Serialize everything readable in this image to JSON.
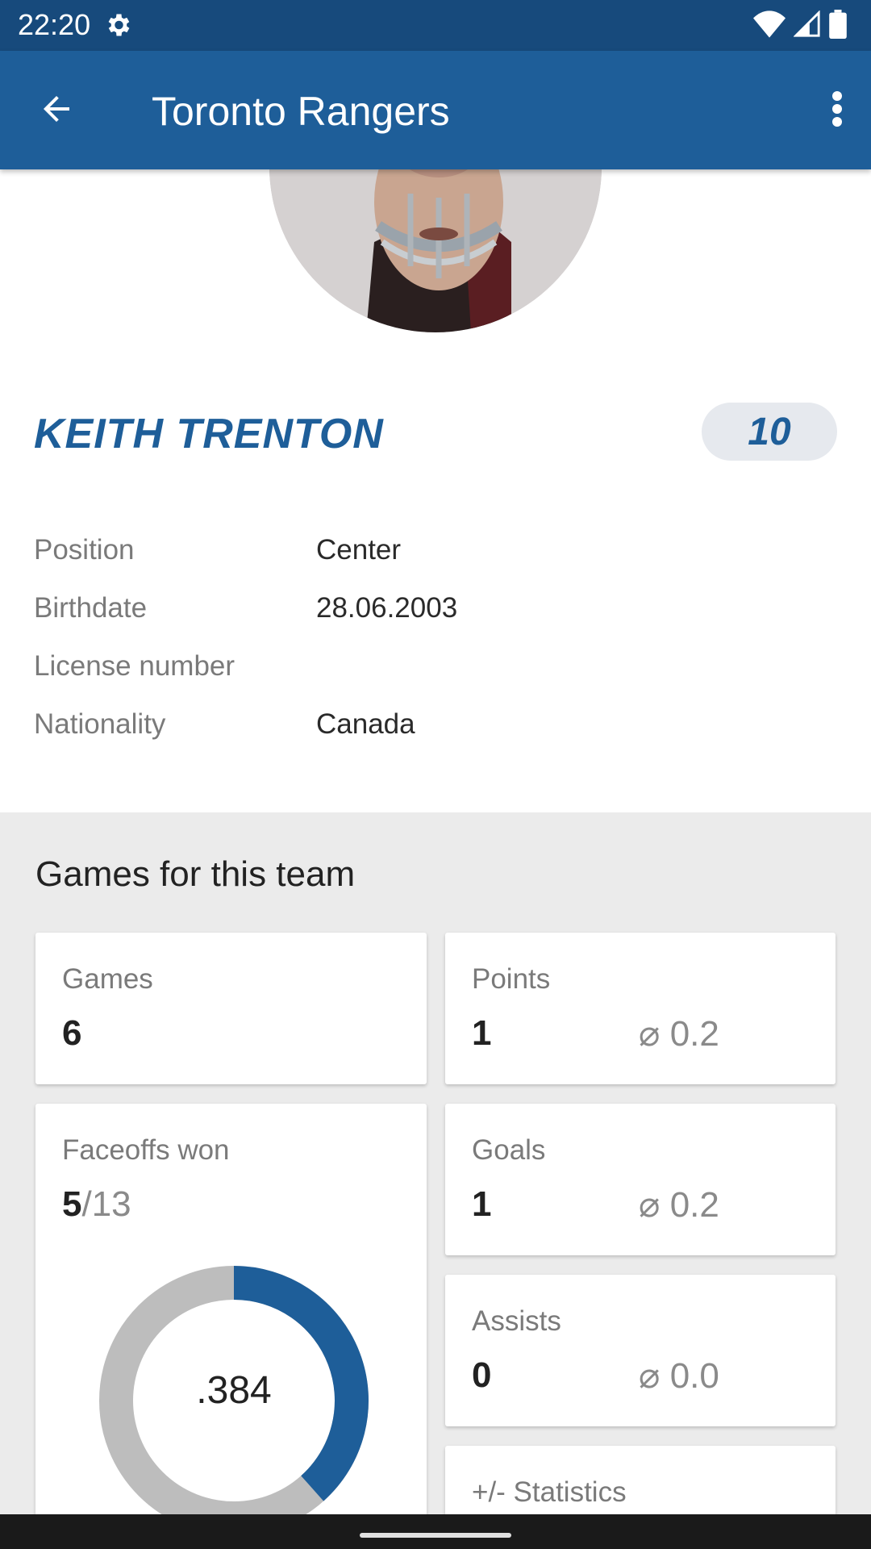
{
  "status_bar": {
    "time": "22:20",
    "icons": [
      "gear-icon",
      "wifi-icon",
      "signal-icon",
      "battery-icon"
    ]
  },
  "app_bar": {
    "title": "Toronto Rangers",
    "back_icon": "arrow-back-icon",
    "more_icon": "more-vert-icon",
    "color": "#1e5e99"
  },
  "player": {
    "name": "KEITH TRENTON",
    "number": "10",
    "info": [
      {
        "label": "Position",
        "value": "Center"
      },
      {
        "label": "Birthdate",
        "value": "28.06.2003"
      },
      {
        "label": "License number",
        "value": ""
      },
      {
        "label": "Nationality",
        "value": "Canada"
      }
    ]
  },
  "games_section": {
    "title": "Games for this team",
    "games": {
      "label": "Games",
      "value": "6"
    },
    "points": {
      "label": "Points",
      "value": "1",
      "avg": "⌀ 0.2"
    },
    "faceoffs": {
      "label": "Faceoffs won",
      "won": "5",
      "total": "/13",
      "ratio_label": ".384",
      "ratio": 0.384
    },
    "goals": {
      "label": "Goals",
      "value": "1",
      "avg": "⌀ 0.2"
    },
    "assists": {
      "label": "Assists",
      "value": "0",
      "avg": "⌀ 0.0"
    },
    "plus_minus": {
      "label": "+/- Statistics"
    }
  },
  "colors": {
    "accent": "#1e5e99",
    "status_bar": "#174a7c",
    "section_bg": "#ebebeb",
    "donut_track": "#bdbdbd"
  }
}
